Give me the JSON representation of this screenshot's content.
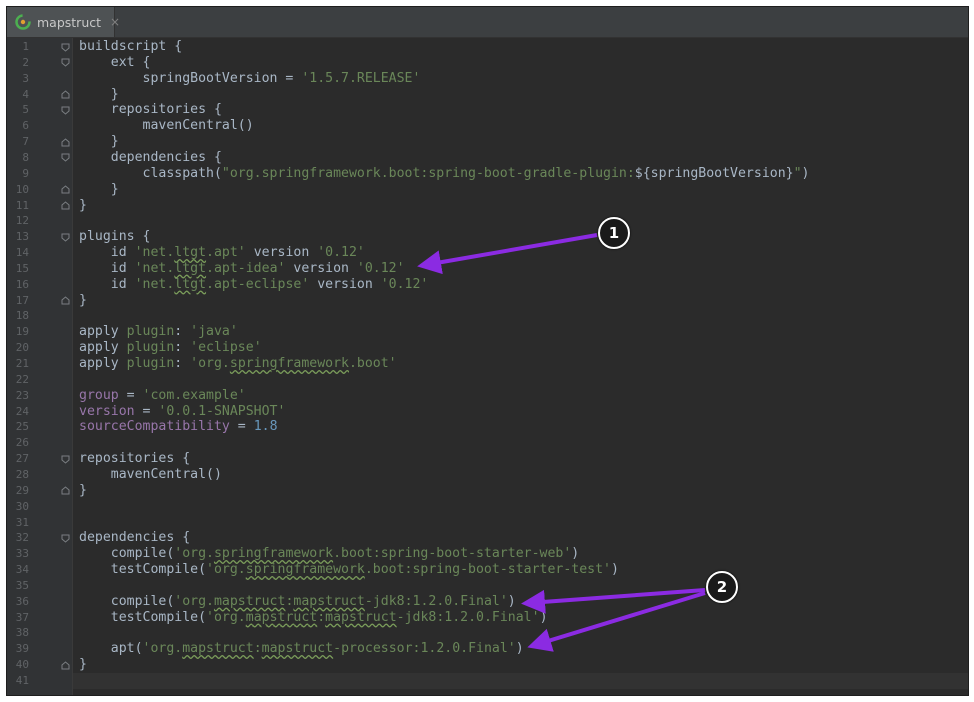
{
  "tab": {
    "label": "mapstruct",
    "close_glyph": "×",
    "icon": "gradle-icon"
  },
  "colors": {
    "background": "#2b2b2b",
    "gutter": "#313335",
    "default_text": "#a9b7c6",
    "string": "#6a8759",
    "property": "#9876aa",
    "number": "#6897bb",
    "arrow": "#8b2be2"
  },
  "code_lines": [
    [
      {
        "t": "buildscript {"
      }
    ],
    [
      {
        "t": "    ext {"
      }
    ],
    [
      {
        "t": "        springBootVersion = "
      },
      {
        "t": "'1.5.7.RELEASE'",
        "c": "s"
      }
    ],
    [
      {
        "t": "    }"
      }
    ],
    [
      {
        "t": "    repositories {"
      }
    ],
    [
      {
        "t": "        mavenCentral()"
      }
    ],
    [
      {
        "t": "    }"
      }
    ],
    [
      {
        "t": "    dependencies {"
      }
    ],
    [
      {
        "t": "        classpath("
      },
      {
        "t": "\"org.springframework.boot:spring-boot-gradle-plugin:",
        "c": "s"
      },
      {
        "t": "${springBootVersion}"
      },
      {
        "t": "\"",
        "c": "s"
      },
      {
        "t": ")"
      }
    ],
    [
      {
        "t": "    }"
      }
    ],
    [
      {
        "t": "}"
      }
    ],
    [],
    [
      {
        "t": "plugins {"
      }
    ],
    [
      {
        "t": "    id "
      },
      {
        "t": "'net.",
        "c": "s"
      },
      {
        "t": "ltgt",
        "c": "s",
        "w": 1
      },
      {
        "t": ".apt'",
        "c": "s"
      },
      {
        "t": " version "
      },
      {
        "t": "'0.12'",
        "c": "s"
      }
    ],
    [
      {
        "t": "    id "
      },
      {
        "t": "'net.",
        "c": "s"
      },
      {
        "t": "ltgt",
        "c": "s",
        "w": 1
      },
      {
        "t": ".apt-idea'",
        "c": "s"
      },
      {
        "t": " version "
      },
      {
        "t": "'0.12'",
        "c": "s"
      }
    ],
    [
      {
        "t": "    id "
      },
      {
        "t": "'net.",
        "c": "s"
      },
      {
        "t": "ltgt",
        "c": "s",
        "w": 1
      },
      {
        "t": ".apt-eclipse'",
        "c": "s"
      },
      {
        "t": " version "
      },
      {
        "t": "'0.12'",
        "c": "s"
      }
    ],
    [
      {
        "t": "}"
      }
    ],
    [],
    [
      {
        "t": "apply "
      },
      {
        "t": "plugin",
        "c": "s"
      },
      {
        "t": ": "
      },
      {
        "t": "'java'",
        "c": "s"
      }
    ],
    [
      {
        "t": "apply "
      },
      {
        "t": "plugin",
        "c": "s"
      },
      {
        "t": ": "
      },
      {
        "t": "'eclipse'",
        "c": "s"
      }
    ],
    [
      {
        "t": "apply "
      },
      {
        "t": "plugin",
        "c": "s"
      },
      {
        "t": ": "
      },
      {
        "t": "'org.",
        "c": "s"
      },
      {
        "t": "springframework",
        "c": "s",
        "w": 1
      },
      {
        "t": ".boot'",
        "c": "s"
      }
    ],
    [],
    [
      {
        "t": "group",
        "c": "p"
      },
      {
        "t": " = "
      },
      {
        "t": "'com.example'",
        "c": "s"
      }
    ],
    [
      {
        "t": "version",
        "c": "p"
      },
      {
        "t": " = "
      },
      {
        "t": "'0.0.1-SNAPSHOT'",
        "c": "s"
      }
    ],
    [
      {
        "t": "sourceCompatibility",
        "c": "p"
      },
      {
        "t": " = "
      },
      {
        "t": "1.8",
        "c": "n"
      }
    ],
    [],
    [
      {
        "t": "repositories {"
      }
    ],
    [
      {
        "t": "    mavenCentral()"
      }
    ],
    [
      {
        "t": "}"
      }
    ],
    [],
    [],
    [
      {
        "t": "dependencies {"
      }
    ],
    [
      {
        "t": "    compile("
      },
      {
        "t": "'org.",
        "c": "s"
      },
      {
        "t": "springframework",
        "c": "s",
        "w": 1
      },
      {
        "t": ".boot:spring-boot-starter-web'",
        "c": "s"
      },
      {
        "t": ")"
      }
    ],
    [
      {
        "t": "    testCompile("
      },
      {
        "t": "'org.",
        "c": "s"
      },
      {
        "t": "springframework",
        "c": "s",
        "w": 1
      },
      {
        "t": ".boot:spring-boot-starter-test'",
        "c": "s"
      },
      {
        "t": ")"
      }
    ],
    [],
    [
      {
        "t": "    compile("
      },
      {
        "t": "'org.",
        "c": "s"
      },
      {
        "t": "mapstruct",
        "c": "s",
        "w": 1
      },
      {
        "t": ":",
        "c": "s"
      },
      {
        "t": "mapstruct",
        "c": "s",
        "w": 1
      },
      {
        "t": "-jdk8:1.2.0.Final'",
        "c": "s"
      },
      {
        "t": ")"
      }
    ],
    [
      {
        "t": "    testCompile("
      },
      {
        "t": "'org.",
        "c": "s"
      },
      {
        "t": "mapstruct",
        "c": "s",
        "w": 1
      },
      {
        "t": ":",
        "c": "s"
      },
      {
        "t": "mapstruct",
        "c": "s",
        "w": 1
      },
      {
        "t": "-jdk8:1.2.0.Final'",
        "c": "s"
      },
      {
        "t": ")"
      }
    ],
    [],
    [
      {
        "t": "    apt("
      },
      {
        "t": "'org.",
        "c": "s"
      },
      {
        "t": "mapstruct",
        "c": "s",
        "w": 1
      },
      {
        "t": ":",
        "c": "s"
      },
      {
        "t": "mapstruct",
        "c": "s",
        "w": 1
      },
      {
        "t": "-processor:1.2.0.Final'",
        "c": "s"
      },
      {
        "t": ")"
      }
    ],
    [
      {
        "t": "}"
      }
    ],
    []
  ],
  "fold_markers": {
    "1": "open",
    "2": "open",
    "4": "close",
    "5": "open",
    "7": "close",
    "8": "open",
    "10": "close",
    "11": "close",
    "13": "open",
    "17": "close",
    "27": "open",
    "29": "close",
    "32": "open",
    "40": "close"
  },
  "current_line": 41,
  "annotations": [
    {
      "label": "1",
      "icon": "callout-arrow-icon"
    },
    {
      "label": "2",
      "icon": "callout-arrow-icon"
    }
  ]
}
